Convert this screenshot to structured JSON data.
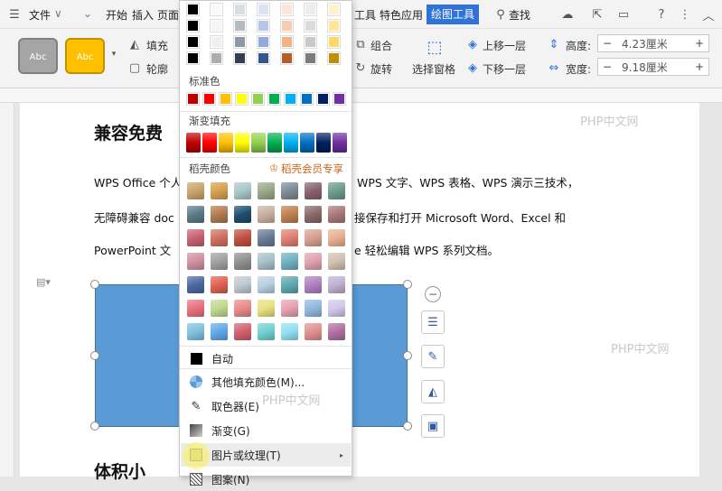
{
  "menubar": {
    "file": "文件",
    "tabs": [
      "开始",
      "插入",
      "页面"
    ],
    "tabs_right": [
      "工具",
      "特色应用"
    ],
    "active_tab": "绘图工具",
    "search": "查找"
  },
  "ribbon": {
    "shape_style_label": "Abc",
    "fill_label": "填充",
    "outline_label": "轮廓",
    "group_label": "组合",
    "rotate_label": "旋转",
    "select_pane_label": "选择窗格",
    "bring_forward_label": "上移一层",
    "send_backward_label": "下移一层",
    "height_label": "高度:",
    "height_value": "4.23厘米",
    "width_label": "宽度:",
    "width_value": "9.18厘米"
  },
  "document": {
    "heading1": "兼容免费",
    "line1_a": "WPS Office 个人",
    "line1_b": "WPS 文字、WPS 表格、WPS 演示三技术，",
    "line2_a": "无障碍兼容 doc",
    "line2_b": "接保存和打开  Microsoft Word、Excel  和",
    "line3_a": "PowerPoint  文",
    "line3_b": "e 轻松编辑 WPS 系列文档。",
    "heading2": "体积小",
    "watermark": "PHP中文网"
  },
  "fill_menu": {
    "standard_colors_label": "标准色",
    "gradient_fill_label": "渐变填充",
    "shell_colors_label": "稻壳颜色",
    "shell_member_label": "稻壳会员专享",
    "auto_label": "自动",
    "other_colors_label": "其他填充颜色(M)...",
    "eyedropper_label": "取色器(E)",
    "gradient_label": "渐变(G)",
    "picture_texture_label": "图片或纹理(T)",
    "pattern_label": "图案(N)"
  },
  "colors": {
    "accent": "#2f73d8",
    "shape_fill": "#5b9bd5",
    "standard": [
      "#c00000",
      "#ff0000",
      "#ffc000",
      "#ffff00",
      "#92d050",
      "#00b050",
      "#00b0f0",
      "#0070c0",
      "#002060",
      "#7030a0"
    ]
  }
}
